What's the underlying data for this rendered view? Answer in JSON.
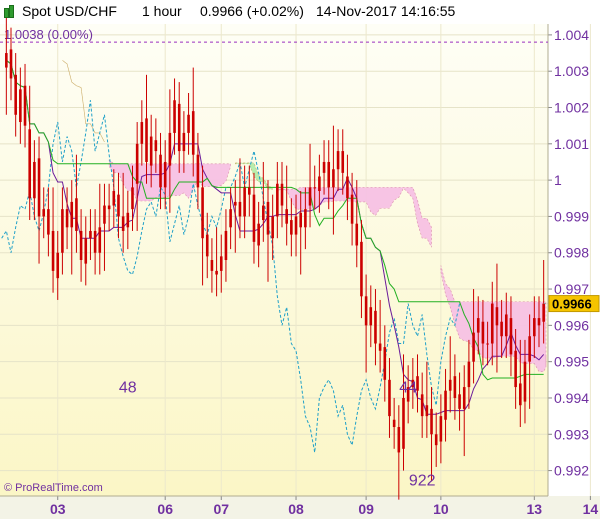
{
  "header": {
    "instrument": "Spot USD/CHF",
    "timeframe": "1 hour",
    "last_quote": "0.9966 (+0.02%)",
    "datetime": "14-Nov-2017 14:16:55"
  },
  "ref_line": {
    "label": "1.0038 (0.00%)",
    "value": 1.0038
  },
  "watermark": "© ProRealTime.com",
  "current_price_label": "0.9966",
  "annotations": [
    {
      "text": "1.0038",
      "x_index": 0,
      "value": 1.0038
    },
    {
      "text": "48",
      "x_index": 26,
      "value": 0.99475
    },
    {
      "text": "44",
      "x_index": 86,
      "value": 0.99475
    },
    {
      "text": "922",
      "x_index": 89,
      "value": 0.9922
    }
  ],
  "colors": {
    "candle": "#cc0000",
    "tenkan": "#6a1b9a",
    "kijun": "#22b022",
    "chikou": "#1fa0c8",
    "cloud_bull": "#b5eeab",
    "cloud_bear": "#f7c2e4",
    "ref_line": "#9a2fbf",
    "annotation": "#7030a0",
    "price_tag": "#f5c400",
    "bg_top": "#fefef6",
    "bg_bottom": "#fbf6c6",
    "axis_text": "#7030a0"
  },
  "chart_data": {
    "type": "ohlc",
    "title": "Spot USD/CHF 1 hour",
    "y_axis": {
      "range": [
        0.9913,
        1.0043
      ],
      "ticks": [
        0.992,
        0.993,
        0.994,
        0.995,
        0.996,
        0.997,
        0.998,
        0.999,
        1,
        1.001,
        1.002,
        1.003,
        1.004
      ],
      "tick_labels": [
        "0.992",
        "0.993",
        "0.994",
        "0.995",
        "0.996",
        "0.997",
        "0.998",
        "0.999",
        "1",
        "1.001",
        "1.002",
        "1.003",
        "1.004"
      ]
    },
    "x_axis": {
      "labels": [
        "03",
        "06",
        "07",
        "08",
        "09",
        "10",
        "13",
        "14"
      ],
      "label_positions_index": [
        11,
        34,
        46,
        62,
        77,
        93,
        113,
        125
      ]
    },
    "grid": true,
    "series": [
      {
        "name": "price",
        "close": [
          1.0035,
          1.0028,
          1.0018,
          1.0025,
          1.0015,
          0.9995,
          1.0005,
          0.999,
          0.9992,
          0.9985,
          0.9975,
          0.998,
          0.9992,
          0.9987,
          0.9994,
          0.9986,
          0.9978,
          0.9984,
          0.9986,
          0.998,
          0.9987,
          0.9993,
          0.9992,
          0.9997,
          0.999,
          0.9986,
          0.9991,
          0.9998,
          1.001,
          1.0016,
          1.0005,
          1.0012,
          1.0008,
          0.9998,
          1.0005,
          1.0013,
          1.0022,
          1.0008,
          1.0013,
          1.0018,
          1.0007,
          0.9998,
          0.9984,
          0.9979,
          0.9975,
          0.9974,
          0.9979,
          0.9986,
          0.9992,
          0.9994,
          0.999,
          0.9998,
          0.9996,
          0.9983,
          0.9988,
          0.9993,
          0.9985,
          0.999,
          0.9999,
          0.9993,
          0.9988,
          0.9985,
          0.999,
          0.9987,
          0.9992,
          0.9998,
          0.9998,
          1.0001,
          1.0005,
          0.9998,
          1.0003,
          1.0008,
          1.0002,
          0.9995,
          0.9988,
          0.9982,
          0.9968,
          0.996,
          0.9965,
          0.9955,
          0.9953,
          0.9945,
          0.9935,
          0.9932,
          0.9925,
          0.994,
          0.9943,
          0.9945,
          0.9942,
          0.9935,
          0.9938,
          0.993,
          0.9927,
          0.9935,
          0.9942,
          0.9945,
          0.994,
          0.9937,
          0.9943,
          0.995,
          0.9958,
          0.9962,
          0.9955,
          0.9955,
          0.9966,
          0.996,
          0.9957,
          0.9963,
          0.9952,
          0.9943,
          0.9938,
          0.995,
          0.9957,
          0.9962,
          0.996,
          0.9966
        ],
        "open": [
          1.0031,
          1.0036,
          1.0029,
          1.0016,
          1.0026,
          1.0014,
          0.9995,
          1.0006,
          0.999,
          0.9992,
          0.9986,
          0.9973,
          0.998,
          0.9992,
          0.9987,
          0.9995,
          0.9986,
          0.9977,
          0.9984,
          0.9986,
          0.998,
          0.9988,
          0.9993,
          0.9993,
          0.9996,
          0.999,
          0.9987,
          0.9992,
          0.9999,
          1.001,
          1.0017,
          1.0004,
          1.0011,
          1.0007,
          0.9998,
          1.0004,
          1.0013,
          1.0021,
          1.0008,
          1.0013,
          1.0019,
          1.0007,
          0.9998,
          0.9985,
          0.9978,
          0.9975,
          0.9975,
          0.9978,
          0.9987,
          0.9993,
          0.9994,
          0.999,
          0.9998,
          0.9996,
          0.9982,
          0.9989,
          0.9994,
          0.9984,
          0.999,
          0.9999,
          0.9992,
          0.9989,
          0.9985,
          0.9991,
          0.9987,
          0.9993,
          0.9998,
          0.9997,
          1.0002,
          1.0005,
          0.9998,
          1.0003,
          1.0008,
          1.0001,
          0.9996,
          0.9988,
          0.9983,
          0.9968,
          0.996,
          0.9964,
          0.9955,
          0.9954,
          0.9945,
          0.9934,
          0.9932,
          0.9926,
          0.9939,
          0.9943,
          0.9946,
          0.9941,
          0.9935,
          0.9937,
          0.993,
          0.9928,
          0.9934,
          0.9942,
          0.9946,
          0.9941,
          0.9937,
          0.9943,
          0.995,
          0.9958,
          0.9961,
          0.9955,
          0.9955,
          0.9965,
          0.9961,
          0.9957,
          0.9962,
          0.9953,
          0.9944,
          0.9939,
          0.995,
          0.9957,
          0.9962,
          0.9961
        ]
      }
    ]
  }
}
